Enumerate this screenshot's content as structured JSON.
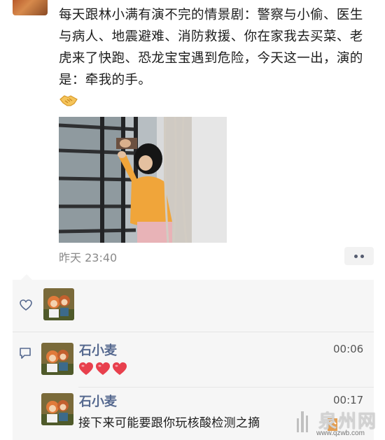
{
  "post": {
    "text": "每天跟林小满有演不完的情景剧：警察与小偷、医生与病人、地震避难、消防救援、你在家我去买菜、老虎来了快跑、恐龙宝宝遇到危险，今天这一出，演的是：牵我的手。",
    "emoji_icon": "handshake-icon",
    "time": "昨天 23:40"
  },
  "comments": [
    {
      "author": "石小麦",
      "time": "00:06",
      "content_icons": [
        "heart-icon",
        "heart-icon",
        "heart-icon"
      ]
    },
    {
      "author": "石小麦",
      "time": "00:17",
      "text": "接下来可能要跟你玩核酸检测之摘"
    }
  ],
  "watermark": {
    "text": "泉州网",
    "url": "www.qzwb.com"
  },
  "colors": {
    "name_link": "#56698f",
    "heart_red": "#e8404d",
    "panel_bg": "#f6f6f6",
    "time_gray": "#8a8a8a"
  }
}
